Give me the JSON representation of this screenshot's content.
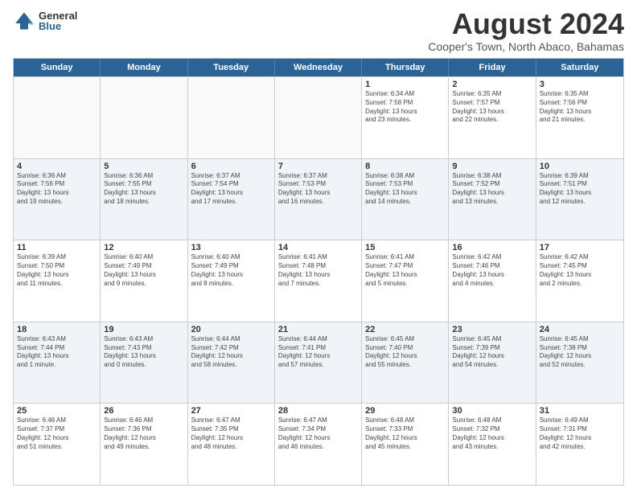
{
  "logo": {
    "general": "General",
    "blue": "Blue"
  },
  "title": "August 2024",
  "subtitle": "Cooper's Town, North Abaco, Bahamas",
  "header_days": [
    "Sunday",
    "Monday",
    "Tuesday",
    "Wednesday",
    "Thursday",
    "Friday",
    "Saturday"
  ],
  "rows": [
    [
      {
        "day": "",
        "info": ""
      },
      {
        "day": "",
        "info": ""
      },
      {
        "day": "",
        "info": ""
      },
      {
        "day": "",
        "info": ""
      },
      {
        "day": "1",
        "info": "Sunrise: 6:34 AM\nSunset: 7:58 PM\nDaylight: 13 hours\nand 23 minutes."
      },
      {
        "day": "2",
        "info": "Sunrise: 6:35 AM\nSunset: 7:57 PM\nDaylight: 13 hours\nand 22 minutes."
      },
      {
        "day": "3",
        "info": "Sunrise: 6:35 AM\nSunset: 7:56 PM\nDaylight: 13 hours\nand 21 minutes."
      }
    ],
    [
      {
        "day": "4",
        "info": "Sunrise: 6:36 AM\nSunset: 7:56 PM\nDaylight: 13 hours\nand 19 minutes."
      },
      {
        "day": "5",
        "info": "Sunrise: 6:36 AM\nSunset: 7:55 PM\nDaylight: 13 hours\nand 18 minutes."
      },
      {
        "day": "6",
        "info": "Sunrise: 6:37 AM\nSunset: 7:54 PM\nDaylight: 13 hours\nand 17 minutes."
      },
      {
        "day": "7",
        "info": "Sunrise: 6:37 AM\nSunset: 7:53 PM\nDaylight: 13 hours\nand 16 minutes."
      },
      {
        "day": "8",
        "info": "Sunrise: 6:38 AM\nSunset: 7:53 PM\nDaylight: 13 hours\nand 14 minutes."
      },
      {
        "day": "9",
        "info": "Sunrise: 6:38 AM\nSunset: 7:52 PM\nDaylight: 13 hours\nand 13 minutes."
      },
      {
        "day": "10",
        "info": "Sunrise: 6:39 AM\nSunset: 7:51 PM\nDaylight: 13 hours\nand 12 minutes."
      }
    ],
    [
      {
        "day": "11",
        "info": "Sunrise: 6:39 AM\nSunset: 7:50 PM\nDaylight: 13 hours\nand 11 minutes."
      },
      {
        "day": "12",
        "info": "Sunrise: 6:40 AM\nSunset: 7:49 PM\nDaylight: 13 hours\nand 9 minutes."
      },
      {
        "day": "13",
        "info": "Sunrise: 6:40 AM\nSunset: 7:49 PM\nDaylight: 13 hours\nand 8 minutes."
      },
      {
        "day": "14",
        "info": "Sunrise: 6:41 AM\nSunset: 7:48 PM\nDaylight: 13 hours\nand 7 minutes."
      },
      {
        "day": "15",
        "info": "Sunrise: 6:41 AM\nSunset: 7:47 PM\nDaylight: 13 hours\nand 5 minutes."
      },
      {
        "day": "16",
        "info": "Sunrise: 6:42 AM\nSunset: 7:46 PM\nDaylight: 13 hours\nand 4 minutes."
      },
      {
        "day": "17",
        "info": "Sunrise: 6:42 AM\nSunset: 7:45 PM\nDaylight: 13 hours\nand 2 minutes."
      }
    ],
    [
      {
        "day": "18",
        "info": "Sunrise: 6:43 AM\nSunset: 7:44 PM\nDaylight: 13 hours\nand 1 minute."
      },
      {
        "day": "19",
        "info": "Sunrise: 6:43 AM\nSunset: 7:43 PM\nDaylight: 13 hours\nand 0 minutes."
      },
      {
        "day": "20",
        "info": "Sunrise: 6:44 AM\nSunset: 7:42 PM\nDaylight: 12 hours\nand 58 minutes."
      },
      {
        "day": "21",
        "info": "Sunrise: 6:44 AM\nSunset: 7:41 PM\nDaylight: 12 hours\nand 57 minutes."
      },
      {
        "day": "22",
        "info": "Sunrise: 6:45 AM\nSunset: 7:40 PM\nDaylight: 12 hours\nand 55 minutes."
      },
      {
        "day": "23",
        "info": "Sunrise: 6:45 AM\nSunset: 7:39 PM\nDaylight: 12 hours\nand 54 minutes."
      },
      {
        "day": "24",
        "info": "Sunrise: 6:45 AM\nSunset: 7:38 PM\nDaylight: 12 hours\nand 52 minutes."
      }
    ],
    [
      {
        "day": "25",
        "info": "Sunrise: 6:46 AM\nSunset: 7:37 PM\nDaylight: 12 hours\nand 51 minutes."
      },
      {
        "day": "26",
        "info": "Sunrise: 6:46 AM\nSunset: 7:36 PM\nDaylight: 12 hours\nand 49 minutes."
      },
      {
        "day": "27",
        "info": "Sunrise: 6:47 AM\nSunset: 7:35 PM\nDaylight: 12 hours\nand 48 minutes."
      },
      {
        "day": "28",
        "info": "Sunrise: 6:47 AM\nSunset: 7:34 PM\nDaylight: 12 hours\nand 46 minutes."
      },
      {
        "day": "29",
        "info": "Sunrise: 6:48 AM\nSunset: 7:33 PM\nDaylight: 12 hours\nand 45 minutes."
      },
      {
        "day": "30",
        "info": "Sunrise: 6:48 AM\nSunset: 7:32 PM\nDaylight: 12 hours\nand 43 minutes."
      },
      {
        "day": "31",
        "info": "Sunrise: 6:49 AM\nSunset: 7:31 PM\nDaylight: 12 hours\nand 42 minutes."
      }
    ]
  ]
}
